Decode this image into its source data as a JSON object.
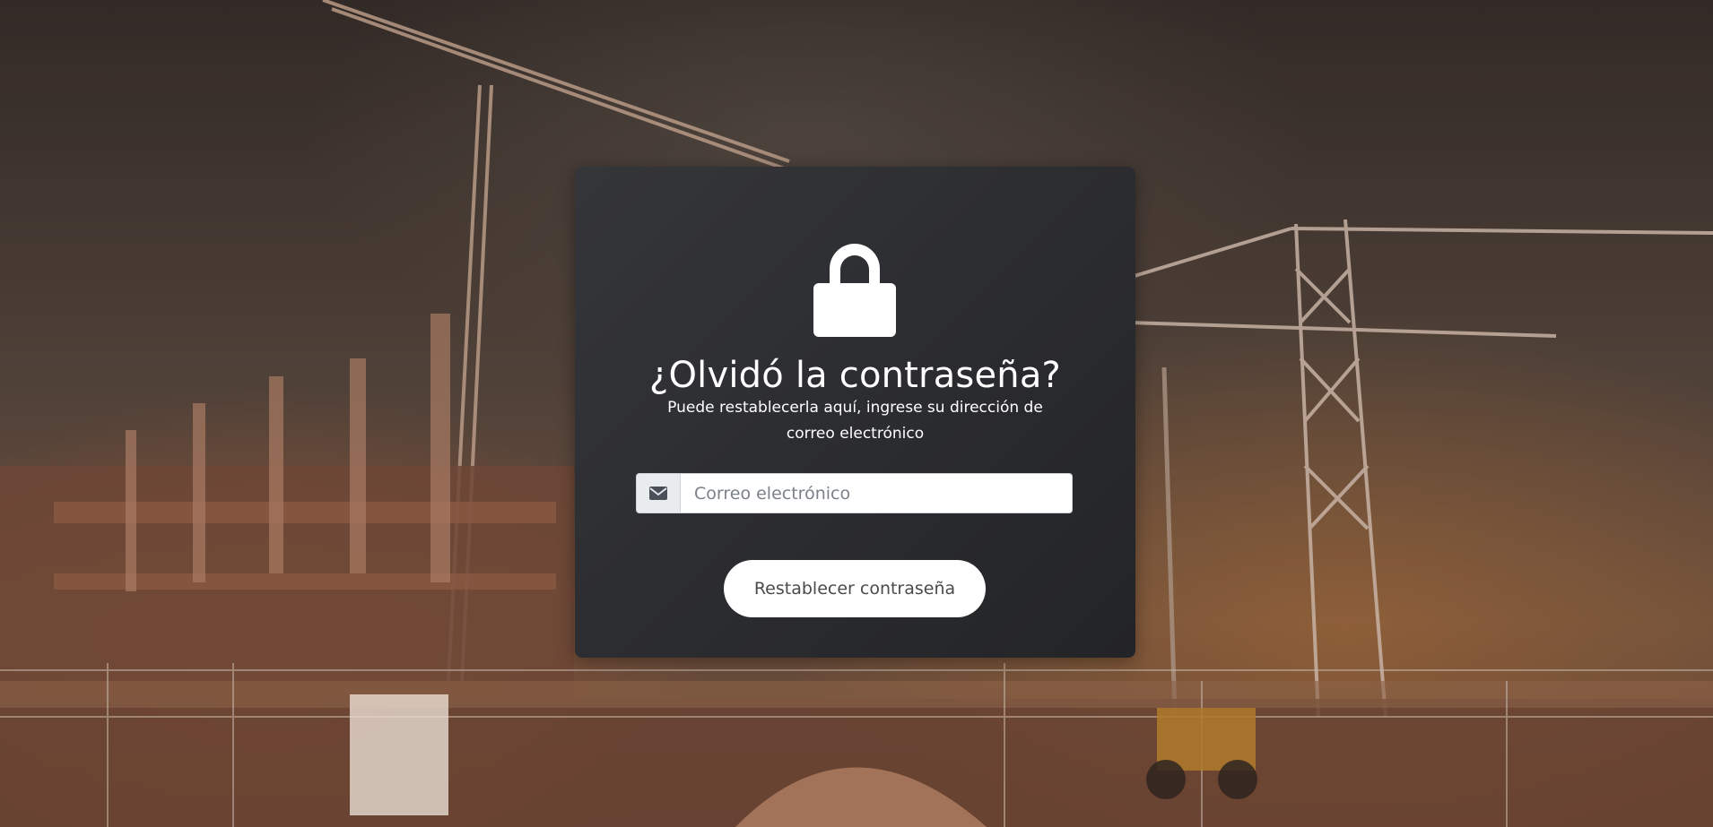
{
  "background": {
    "description_icon": "construction-site-background"
  },
  "card": {
    "icon": "lock-icon",
    "title": "¿Olvidó la contraseña?",
    "subtitle": "Puede restablecerla aquí, ingrese su dirección de correo electrónico",
    "email_field": {
      "icon": "envelope-icon",
      "value": "",
      "placeholder": "Correo electrónico"
    },
    "submit_label": "Restablecer contraseña"
  },
  "colors": {
    "card_background": "#2b2c2f",
    "button_background": "#ffffff",
    "button_text": "#4a4a4a",
    "text": "#ffffff"
  }
}
